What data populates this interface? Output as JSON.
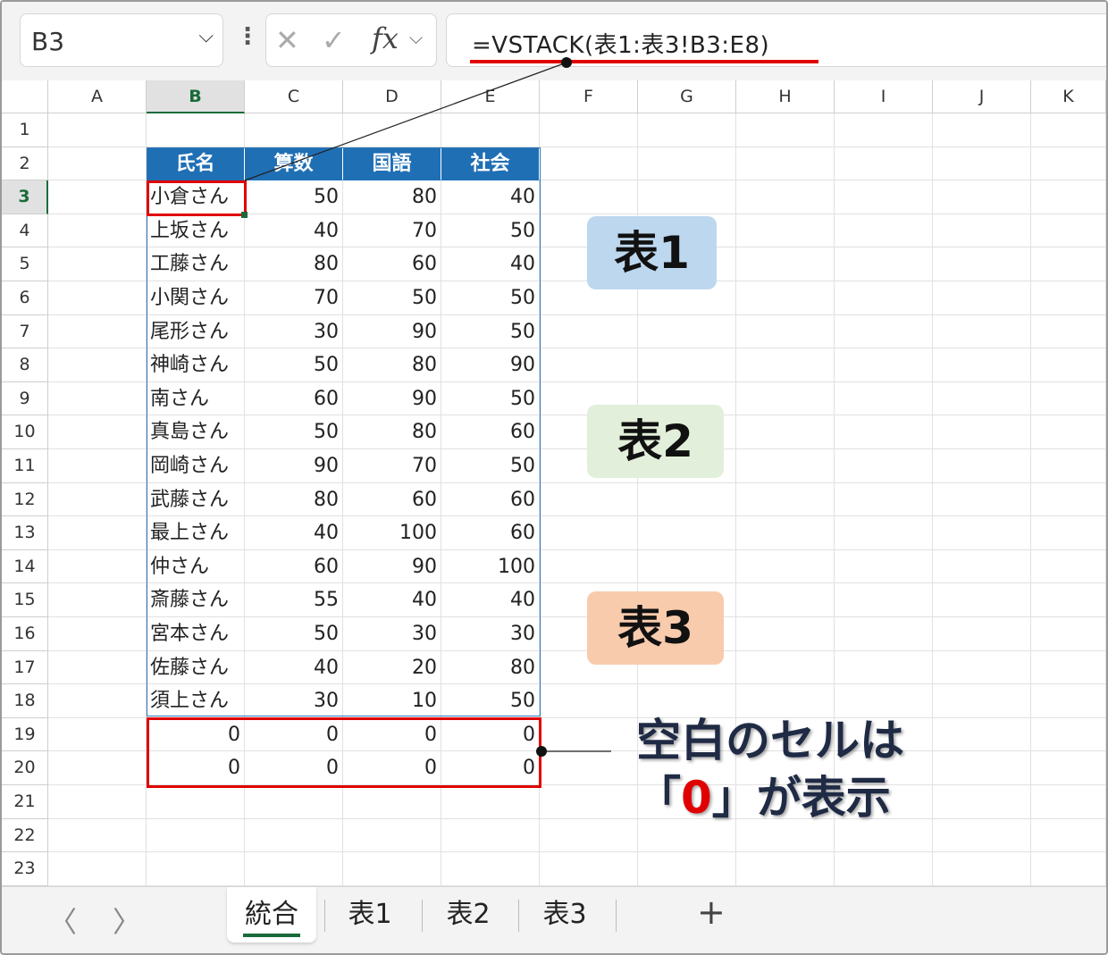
{
  "formula_bar": {
    "name_box": "B3",
    "dots": "⋮",
    "cancel": "✕",
    "enter": "✓",
    "fx": "fx",
    "formula": "=VSTACK(表1:表3!B3:E8)"
  },
  "columns": [
    "A",
    "B",
    "C",
    "D",
    "E",
    "F",
    "G",
    "H",
    "I",
    "J",
    "K"
  ],
  "rows": [
    "1",
    "2",
    "3",
    "4",
    "5",
    "6",
    "7",
    "8",
    "9",
    "10",
    "11",
    "12",
    "13",
    "14",
    "15",
    "16",
    "17",
    "18",
    "19",
    "20",
    "21",
    "22",
    "23"
  ],
  "selected": {
    "column": "B",
    "row": "3"
  },
  "table": {
    "headers": [
      "氏名",
      "算数",
      "国語",
      "社会"
    ],
    "data": [
      [
        "小倉さん",
        "50",
        "80",
        "40"
      ],
      [
        "上坂さん",
        "40",
        "70",
        "50"
      ],
      [
        "工藤さん",
        "80",
        "60",
        "40"
      ],
      [
        "小関さん",
        "70",
        "50",
        "50"
      ],
      [
        "尾形さん",
        "30",
        "90",
        "50"
      ],
      [
        "神崎さん",
        "50",
        "80",
        "90"
      ],
      [
        "南さん",
        "60",
        "90",
        "50"
      ],
      [
        "真島さん",
        "50",
        "80",
        "60"
      ],
      [
        "岡崎さん",
        "90",
        "70",
        "50"
      ],
      [
        "武藤さん",
        "80",
        "60",
        "60"
      ],
      [
        "最上さん",
        "40",
        "100",
        "60"
      ],
      [
        "仲さん",
        "60",
        "90",
        "100"
      ],
      [
        "斎藤さん",
        "55",
        "40",
        "40"
      ],
      [
        "宮本さん",
        "50",
        "30",
        "30"
      ],
      [
        "佐藤さん",
        "40",
        "20",
        "80"
      ],
      [
        "須上さん",
        "30",
        "10",
        "50"
      ],
      [
        "0",
        "0",
        "0",
        "0"
      ],
      [
        "0",
        "0",
        "0",
        "0"
      ]
    ]
  },
  "callouts": {
    "table1": "表1",
    "table2": "表2",
    "table3": "表3",
    "blank_line1": "空白のセルは",
    "blank_open": "「",
    "blank_zero": "0",
    "blank_close": "」が表示"
  },
  "sheet_tabs": [
    "統合",
    "表1",
    "表2",
    "表3"
  ],
  "active_tab": "統合",
  "nav": {
    "prev": "〈",
    "next": "〉",
    "add": "+"
  },
  "colors": {
    "header_blue": "#1f6fb5",
    "highlight_red": "#e00000",
    "accent_green": "#1a6b3a"
  }
}
